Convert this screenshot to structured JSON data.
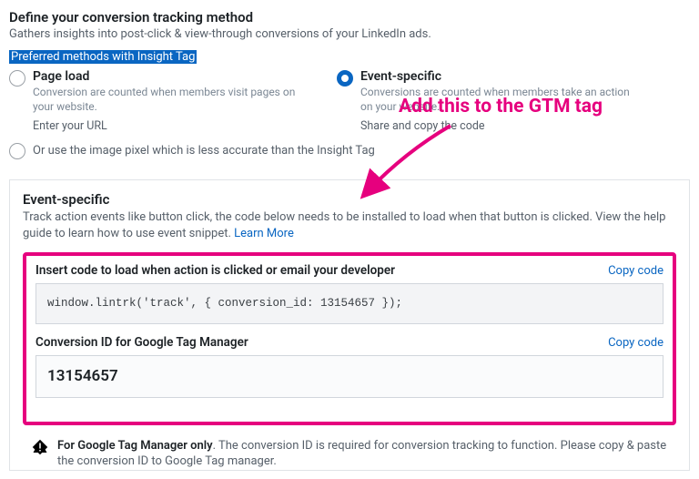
{
  "header": {
    "title": "Define your conversion tracking method",
    "subtitle": "Gathers insights into post-click & view-through conversions of your LinkedIn ads.",
    "highlighted_label": "Preferred methods with Insight Tag"
  },
  "options": {
    "page_load": {
      "title": "Page load",
      "desc": "Conversion are counted when members visit pages on your website.",
      "sub": "Enter your URL"
    },
    "event_specific": {
      "title": "Event-specific",
      "desc": "Conversions are counted when members take an action on your website.",
      "sub": "Share and copy the code"
    },
    "or_text": "Or use the image pixel which is less accurate than the Insight Tag"
  },
  "panel": {
    "title": "Event-specific",
    "desc": "Track action events like button click, the code below needs to be installed to load when that button is clicked. View the help guide to learn how to use event snippet. ",
    "learn_more": "Learn More"
  },
  "codeSection": {
    "insert_label": "Insert code to load when action is clicked or email your developer",
    "copy_label": "Copy code",
    "snippet": "window.lintrk('track', { conversion_id: 13154657 });",
    "gtm_label": "Conversion ID for Google Tag Manager",
    "conversion_id": "13154657"
  },
  "info": {
    "bold": "For Google Tag Manager only",
    "rest": ". The conversion ID is required for conversion tracking to function. Please copy & paste the conversion ID to Google Tag manager."
  },
  "annotation": {
    "text": "Add this to the GTM tag"
  }
}
